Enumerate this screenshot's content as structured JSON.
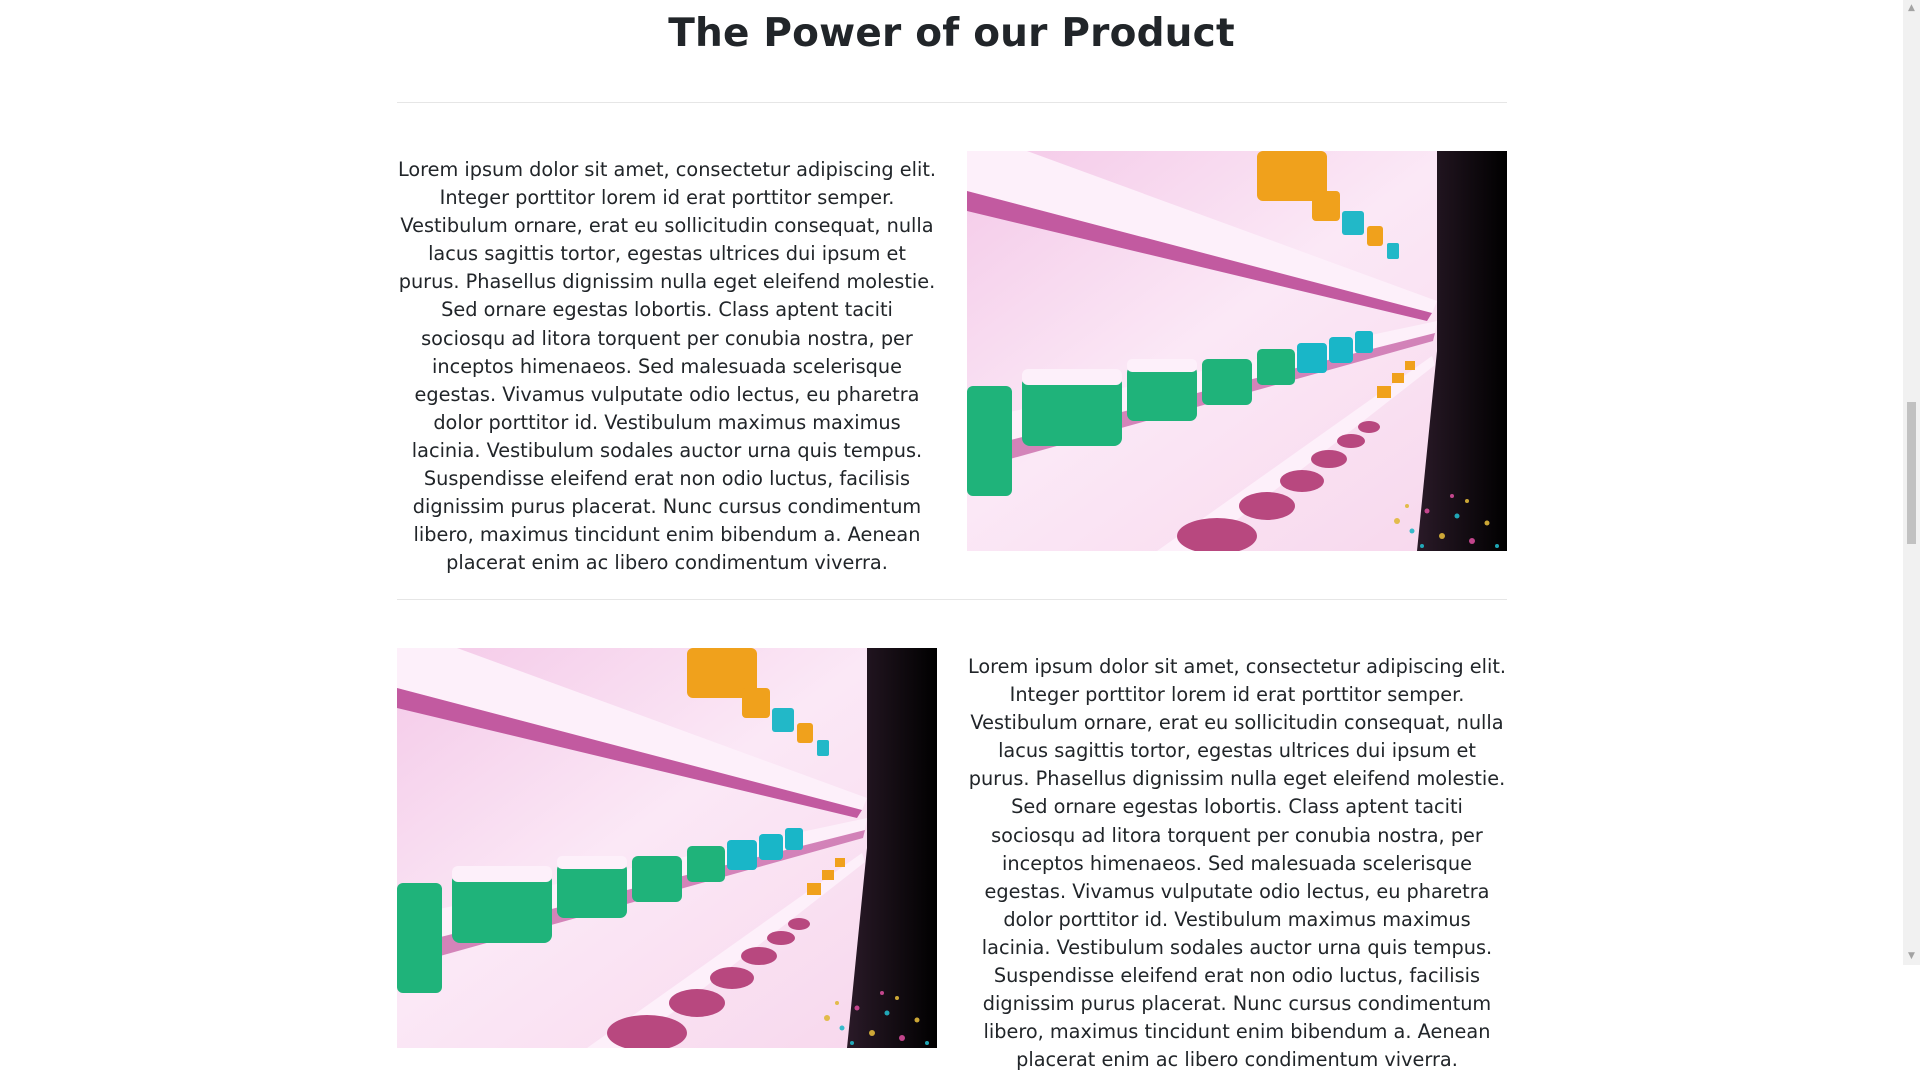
{
  "section": {
    "title": "The Power of our Product",
    "rows": [
      {
        "text": "Lorem ipsum dolor sit amet, consectetur adipiscing elit. Integer porttitor lorem id erat porttitor semper. Vestibulum ornare, erat eu sollicitudin consequat, nulla lacus sagittis tortor, egestas ultrices dui ipsum et purus. Phasellus dignissim nulla eget eleifend molestie. Sed ornare egestas lobortis. Class aptent taciti sociosqu ad litora torquent per conubia nostra, per inceptos himenaeos. Sed malesuada scelerisque egestas. Vivamus vulputate odio lectus, eu pharetra dolor porttitor id. Vestibulum maximus maximus lacinia. Vestibulum sodales auctor urna quis tempus. Suspendisse eleifend erat non odio luctus, facilisis dignissim purus placerat. Nunc cursus condimentum libero, maximus tincidunt enim bibendum a. Aenean placerat enim ac libero condimentum viverra.",
        "image_position": "right"
      },
      {
        "text": "Lorem ipsum dolor sit amet, consectetur adipiscing elit. Integer porttitor lorem id erat porttitor semper. Vestibulum ornare, erat eu sollicitudin consequat, nulla lacus sagittis tortor, egestas ultrices dui ipsum et purus. Phasellus dignissim nulla eget eleifend molestie. Sed ornare egestas lobortis. Class aptent taciti sociosqu ad litora torquent per conubia nostra, per inceptos himenaeos. Sed malesuada scelerisque egestas. Vivamus vulputate odio lectus, eu pharetra dolor porttitor id. Vestibulum maximus maximus lacinia. Vestibulum sodales auctor urna quis tempus. Suspendisse eleifend erat non odio luctus, facilisis dignissim purus placerat. Nunc cursus condimentum libero, maximus tincidunt enim bibendum a. Aenean placerat enim ac libero condimentum viverra.",
        "image_position": "left"
      }
    ]
  },
  "colors": {
    "text": "#212529",
    "divider": "#e6e6e6",
    "shelf_pink": "#f7d6ec",
    "shelf_edge": "#c25aa0",
    "jar_green": "#1fb37a",
    "jar_cyan": "#19b6c8",
    "jar_orange": "#f0a11c",
    "jar_magenta": "#b8487f"
  },
  "scrollbar": {
    "scroll_up_icon": "triangle-up-icon",
    "scroll_down_icon": "triangle-down-icon"
  }
}
